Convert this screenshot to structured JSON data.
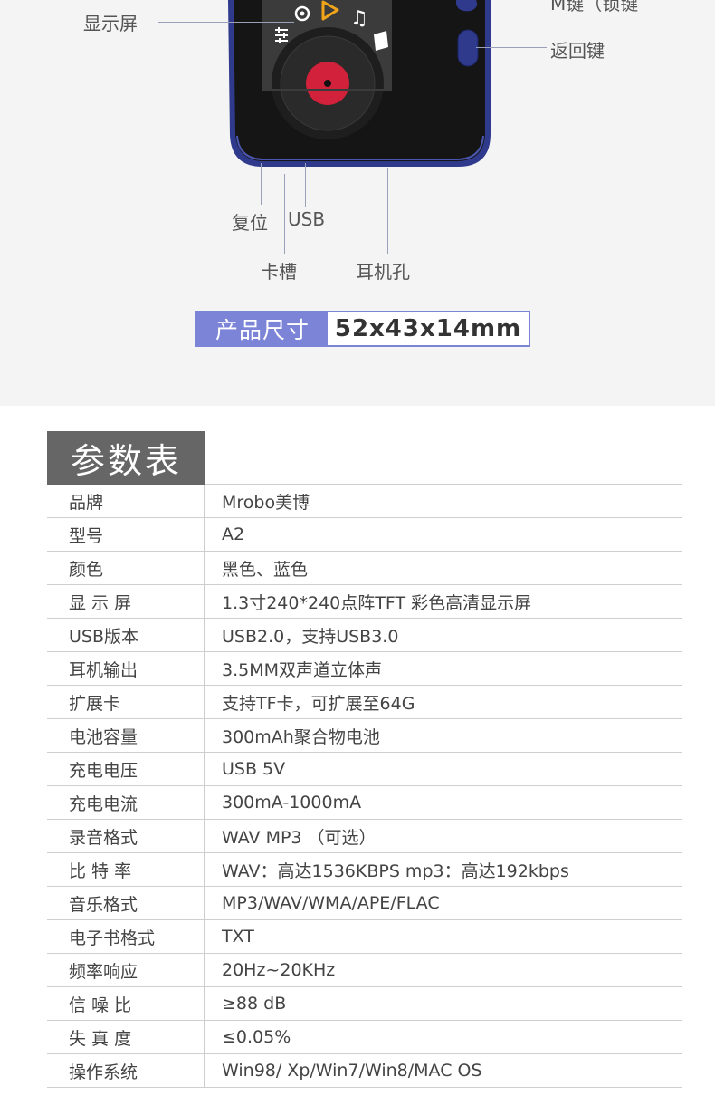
{
  "product_image": {
    "callouts": {
      "display": "显示屏",
      "m_key": "M键（锁键",
      "back_key": "返回键",
      "reset": "复位",
      "usb": "USB",
      "card_slot": "卡槽",
      "headphone": "耳机孔"
    },
    "size_label": "产品尺寸",
    "size_value": "52x43x14mm",
    "colors": {
      "device_body": "#2f3a8c",
      "accent": "#7c84d8"
    }
  },
  "spec_table": {
    "title": "参数表",
    "rows": [
      {
        "key": "品牌",
        "value": "Mrobo美博"
      },
      {
        "key": "型号",
        "value": "A2"
      },
      {
        "key": "颜色",
        "value": "黑色、蓝色"
      },
      {
        "key": "显 示 屏",
        "value": "1.3寸240*240点阵TFT 彩色高清显示屏"
      },
      {
        "key": "USB版本",
        "value": "USB2.0，支持USB3.0"
      },
      {
        "key": "耳机输出",
        "value": "3.5MM双声道立体声"
      },
      {
        "key": "扩展卡",
        "value": "支持TF卡，可扩展至64G"
      },
      {
        "key": "电池容量",
        "value": "300mAh聚合物电池"
      },
      {
        "key": "充电电压",
        "value": "USB 5V"
      },
      {
        "key": "充电电流",
        "value": "300mA-1000mA"
      },
      {
        "key": "录音格式",
        "value": "WAV  MP3 （可选）"
      },
      {
        "key": "比 特 率",
        "value": "WAV：高达1536KBPS  mp3：高达192kbps"
      },
      {
        "key": "音乐格式",
        "value": "MP3/WAV/WMA/APE/FLAC"
      },
      {
        "key": "电子书格式",
        "value": "TXT"
      },
      {
        "key": "频率响应",
        "value": "20Hz~20KHz"
      },
      {
        "key": "信 噪 比",
        "value": "≥88 dB"
      },
      {
        "key": "失 真 度",
        "value": "≤0.05%"
      },
      {
        "key": "操作系统",
        "value": "Win98/ Xp/Win7/Win8/MAC OS"
      }
    ]
  }
}
